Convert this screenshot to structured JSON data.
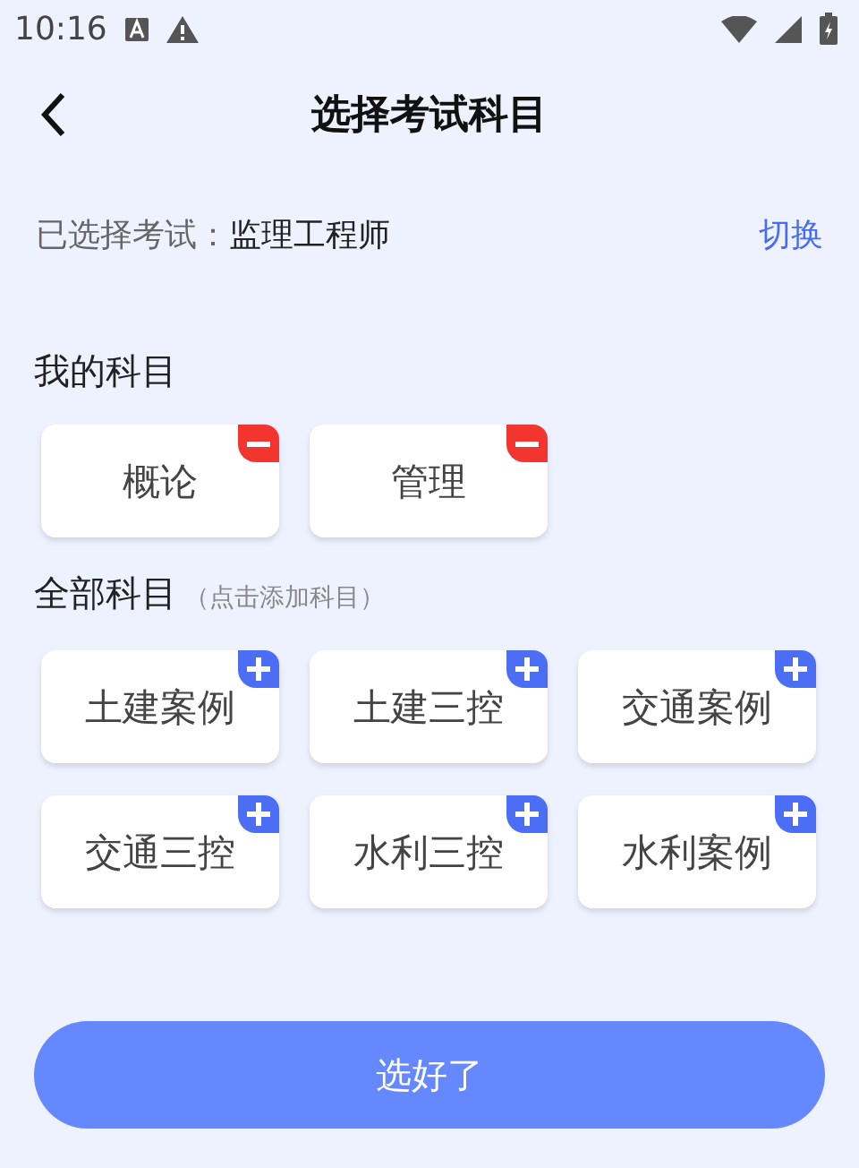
{
  "status_bar": {
    "time": "10:16"
  },
  "header": {
    "title": "选择考试科目"
  },
  "exam": {
    "label": "已选择考试：",
    "value": "监理工程师",
    "switch_link": "切换"
  },
  "my_subjects": {
    "heading": "我的科目",
    "items": [
      {
        "name": "概论",
        "kind": "remove"
      },
      {
        "name": "管理",
        "kind": "remove"
      }
    ]
  },
  "all_subjects": {
    "heading": "全部科目",
    "hint": "（点击添加科目）",
    "items": [
      {
        "name": "土建案例",
        "kind": "add"
      },
      {
        "name": "土建三控",
        "kind": "add"
      },
      {
        "name": "交通案例",
        "kind": "add"
      },
      {
        "name": "交通三控",
        "kind": "add"
      },
      {
        "name": "水利三控",
        "kind": "add"
      },
      {
        "name": "水利案例",
        "kind": "add"
      }
    ]
  },
  "confirm_button": "选好了"
}
